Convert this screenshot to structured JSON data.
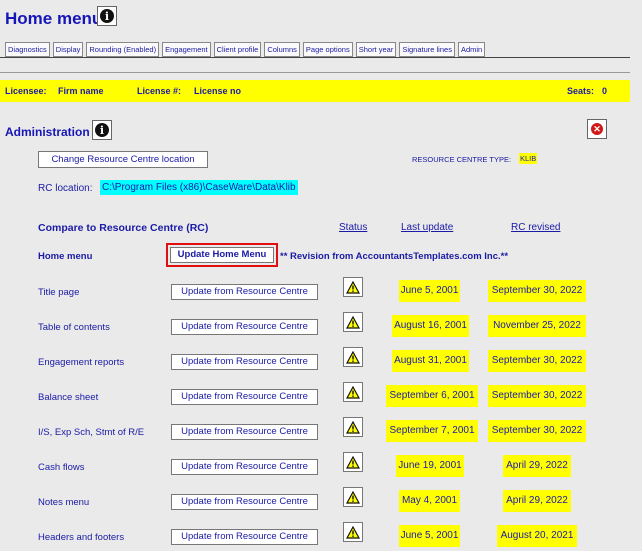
{
  "header": {
    "title": "Home menu"
  },
  "tabs": [
    "Diagnostics",
    "Display",
    "Rounding (Enabled)",
    "Engagement",
    "Client profile",
    "Columns",
    "Page options",
    "Short year",
    "Signature lines",
    "Admin"
  ],
  "license": {
    "licensee_label": "Licensee:",
    "licensee_value": "Firm name",
    "license_label": "License #:",
    "license_value": "License no",
    "seats_label": "Seats:",
    "seats_value": "0"
  },
  "admin": {
    "title": "Administration",
    "change_rc_button": "Change Resource Centre location",
    "rc_type_label": "RESOURCE CENTRE TYPE:",
    "rc_type_value": "KLIB",
    "rc_location_label": "RC location:",
    "rc_location_value": "C:\\Program Files (x86)\\CaseWare\\Data\\Klib"
  },
  "compare": {
    "title": "Compare to Resource Centre (RC)",
    "col_status": "Status",
    "col_last_update": "Last update",
    "col_rc_revised": "RC revised",
    "home_menu_label": "Home menu",
    "home_menu_button": "Update Home Menu",
    "revision_text": "** Revision from AccountantsTemplates.com Inc.**",
    "update_button_label": "Update from Resource Centre",
    "rows": [
      {
        "label": "Title page",
        "last_update": "June 5, 2001",
        "rc_revised": "September 30, 2022"
      },
      {
        "label": "Table of contents",
        "last_update": "August 16, 2001",
        "rc_revised": "November 25, 2022"
      },
      {
        "label": "Engagement reports",
        "last_update": "August 31, 2001",
        "rc_revised": "September 30, 2022"
      },
      {
        "label": "Balance sheet",
        "last_update": "September 6, 2001",
        "rc_revised": "September 30, 2022"
      },
      {
        "label": "I/S, Exp Sch, Stmt of R/E",
        "last_update": "September 7, 2001",
        "rc_revised": "September 30, 2022"
      },
      {
        "label": "Cash flows",
        "last_update": "June 19, 2001",
        "rc_revised": "April 29, 2022"
      },
      {
        "label": "Notes menu",
        "last_update": "May 4, 2001",
        "rc_revised": "April 29, 2022"
      },
      {
        "label": "Headers and footers",
        "last_update": "June 5, 2001",
        "rc_revised": "August 20, 2021"
      }
    ]
  },
  "icons": {
    "info": "info-icon",
    "close": "close-icon",
    "warning": "warning-icon"
  },
  "colors": {
    "highlight_yellow": "#ffff00",
    "highlight_cyan": "#00ffff",
    "text_blue": "#1a1aa6",
    "emphasis_red": "#e01010"
  }
}
